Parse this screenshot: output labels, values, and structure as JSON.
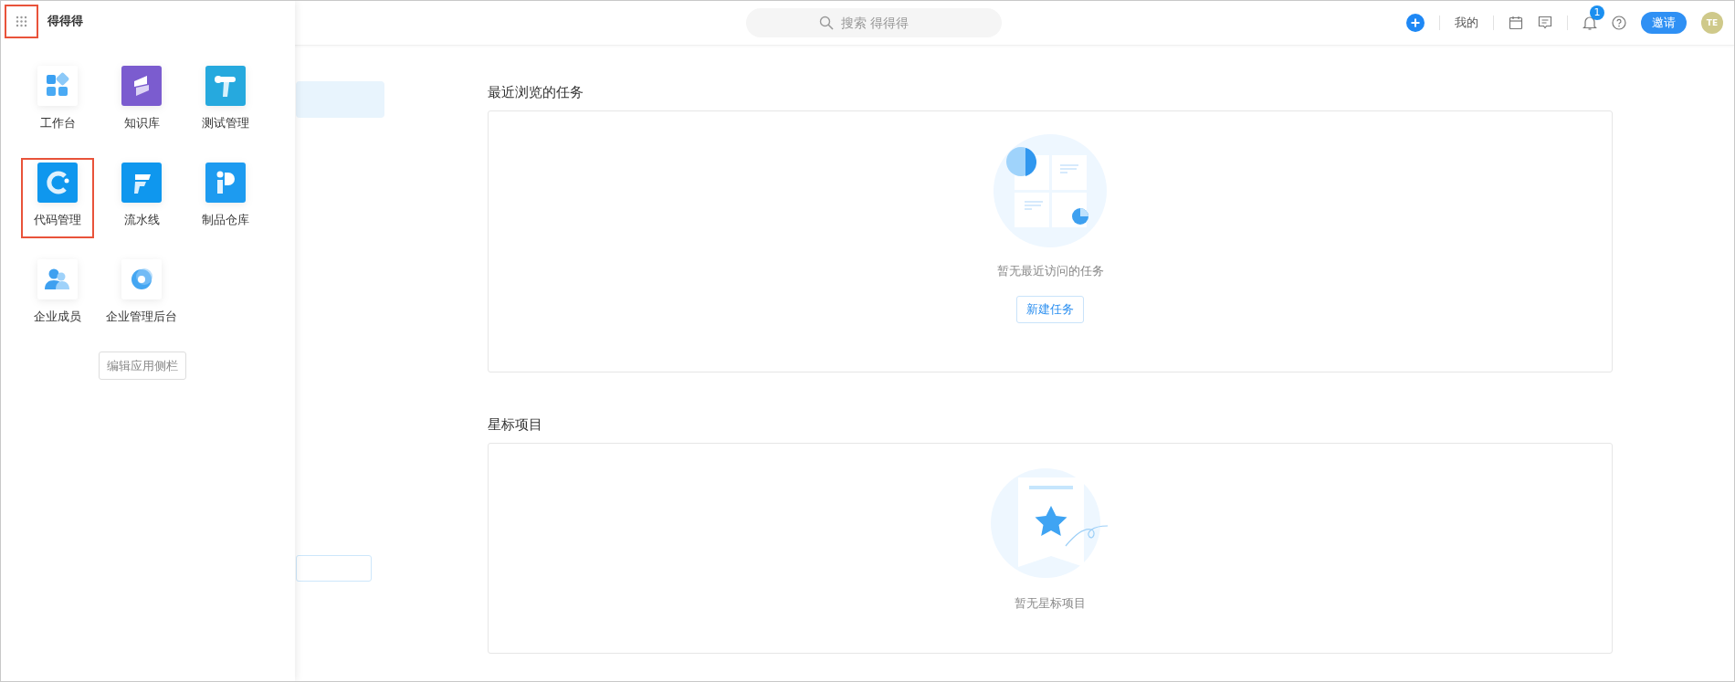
{
  "app_drawer": {
    "menu_highlighted": true,
    "title": "得得得",
    "apps": [
      {
        "label": "工作台",
        "kind": "workbench",
        "highlighted": false
      },
      {
        "label": "知识库",
        "kind": "knowledge",
        "highlighted": false
      },
      {
        "label": "测试管理",
        "kind": "test",
        "highlighted": false
      },
      {
        "label": "代码管理",
        "kind": "code",
        "highlighted": true
      },
      {
        "label": "流水线",
        "kind": "pipeline",
        "highlighted": false
      },
      {
        "label": "制品仓库",
        "kind": "artifact",
        "highlighted": false
      },
      {
        "label": "企业成员",
        "kind": "members",
        "highlighted": false
      },
      {
        "label": "企业管理后台",
        "kind": "admin",
        "highlighted": false
      }
    ],
    "edit_button": "编辑应用侧栏"
  },
  "header": {
    "search": {
      "placeholder": "搜索 得得得"
    },
    "my_label": "我的",
    "notification_count": "1",
    "invite_button": "邀请",
    "avatar": "TE"
  },
  "sections": [
    {
      "kind": "tasks",
      "title": "最近浏览的任务",
      "empty_text": "暂无最近访问的任务",
      "action": "新建任务"
    },
    {
      "kind": "starred",
      "title": "星标项目",
      "empty_text": "暂无星标项目"
    }
  ]
}
